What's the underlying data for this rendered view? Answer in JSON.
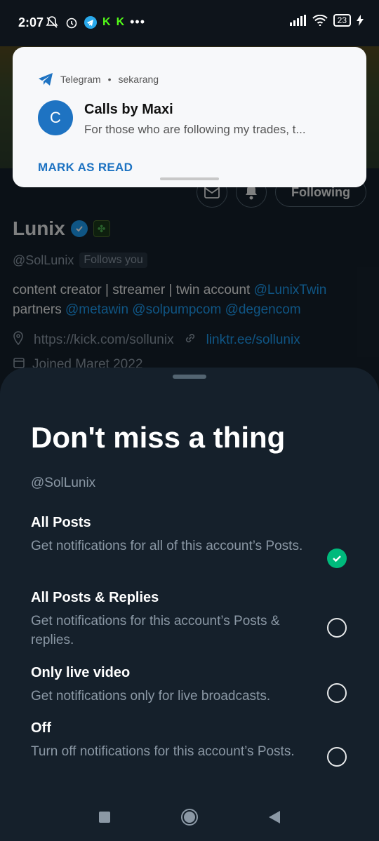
{
  "status_bar": {
    "time": "2:07",
    "battery": "23",
    "left_icons": [
      "bell-off-icon",
      "alarm-icon",
      "telegram-icon",
      "kick-icon",
      "kick-icon",
      "more-dots-icon"
    ],
    "right_icons": [
      "signal-icon",
      "wifi-icon",
      "battery-icon",
      "charging-icon"
    ]
  },
  "notification": {
    "app": "Telegram",
    "separator": "•",
    "time": "sekarang",
    "avatar_letter": "C",
    "title": "Calls by Maxi",
    "message": "For those who are following my trades, t...",
    "action": "MARK AS READ",
    "colors": {
      "accent": "#1e73c2"
    }
  },
  "profile": {
    "name": "Lunix",
    "handle": "@SolLunix",
    "follows_you": "Follows you",
    "following_label": "Following",
    "bio_line1_text": "content creator | streamer | twin account ",
    "bio_line1_link": "@LunixTwin",
    "bio_line2_text": "partners ",
    "bio_line2_links": "@metawin @solpumpcom @degencom",
    "website": "https://kick.com/sollunix",
    "linktree": "linktr.ee/sollunix",
    "joined": "Joined Maret 2022"
  },
  "sheet": {
    "title": "Don't miss a thing",
    "handle": "@SolLunix",
    "options": [
      {
        "title": "All Posts",
        "desc": "Get notifications for all of this account’s Posts.",
        "selected": true
      },
      {
        "title": "All Posts & Replies",
        "desc": "Get notifications for this account’s Posts & replies.",
        "selected": false
      },
      {
        "title": "Only live video",
        "desc": "Get notifications only for live broadcasts.",
        "selected": false
      },
      {
        "title": "Off",
        "desc": "Turn off notifications for this account’s Posts.",
        "selected": false
      }
    ],
    "colors": {
      "selected": "#00ba7c",
      "background": "#15202b"
    }
  },
  "navbar": {
    "icons": [
      "recents-square-icon",
      "home-circle-icon",
      "back-triangle-icon"
    ]
  }
}
